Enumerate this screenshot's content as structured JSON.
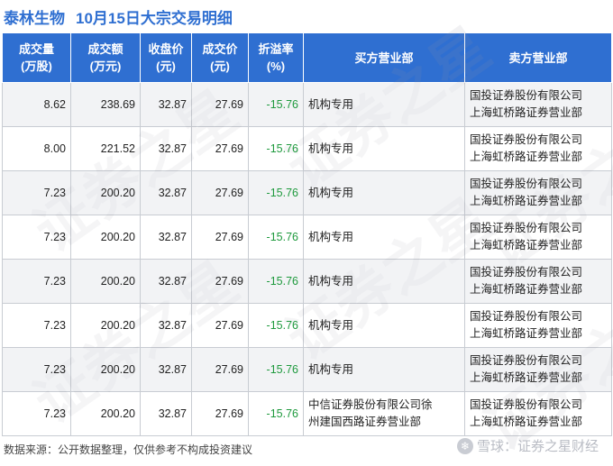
{
  "header": {
    "company": "泰林生物",
    "title": "10月15日大宗交易明细"
  },
  "table": {
    "columns": [
      {
        "l1": "成交量",
        "l2": "(万股)"
      },
      {
        "l1": "成交额",
        "l2": "(万元)"
      },
      {
        "l1": "收盘价",
        "l2": "(元)"
      },
      {
        "l1": "成交价",
        "l2": "(元)"
      },
      {
        "l1": "折溢率",
        "l2": "(%)"
      },
      {
        "l1": "买方营业部",
        "l2": ""
      },
      {
        "l1": "卖方营业部",
        "l2": ""
      }
    ],
    "rows": [
      {
        "volume": "8.62",
        "amount": "238.69",
        "close": "32.87",
        "price": "27.69",
        "premium": "-15.76",
        "buyer1": "机构专用",
        "buyer2": "",
        "seller1": "国投证券股份有限公司",
        "seller2": "上海虹桥路证券营业部"
      },
      {
        "volume": "8.00",
        "amount": "221.52",
        "close": "32.87",
        "price": "27.69",
        "premium": "-15.76",
        "buyer1": "机构专用",
        "buyer2": "",
        "seller1": "国投证券股份有限公司",
        "seller2": "上海虹桥路证券营业部"
      },
      {
        "volume": "7.23",
        "amount": "200.20",
        "close": "32.87",
        "price": "27.69",
        "premium": "-15.76",
        "buyer1": "机构专用",
        "buyer2": "",
        "seller1": "国投证券股份有限公司",
        "seller2": "上海虹桥路证券营业部"
      },
      {
        "volume": "7.23",
        "amount": "200.20",
        "close": "32.87",
        "price": "27.69",
        "premium": "-15.76",
        "buyer1": "机构专用",
        "buyer2": "",
        "seller1": "国投证券股份有限公司",
        "seller2": "上海虹桥路证券营业部"
      },
      {
        "volume": "7.23",
        "amount": "200.20",
        "close": "32.87",
        "price": "27.69",
        "premium": "-15.76",
        "buyer1": "机构专用",
        "buyer2": "",
        "seller1": "国投证券股份有限公司",
        "seller2": "上海虹桥路证券营业部"
      },
      {
        "volume": "7.23",
        "amount": "200.20",
        "close": "32.87",
        "price": "27.69",
        "premium": "-15.76",
        "buyer1": "机构专用",
        "buyer2": "",
        "seller1": "国投证券股份有限公司",
        "seller2": "上海虹桥路证券营业部"
      },
      {
        "volume": "7.23",
        "amount": "200.20",
        "close": "32.87",
        "price": "27.69",
        "premium": "-15.76",
        "buyer1": "机构专用",
        "buyer2": "",
        "seller1": "国投证券股份有限公司",
        "seller2": "上海虹桥路证券营业部"
      },
      {
        "volume": "7.23",
        "amount": "200.20",
        "close": "32.87",
        "price": "27.69",
        "premium": "-15.76",
        "buyer1": "中信证券股份有限公司徐",
        "buyer2": "州建国西路证券营业部",
        "seller1": "国投证券股份有限公司",
        "seller2": "上海虹桥路证券营业部"
      }
    ]
  },
  "footer": {
    "source": "数据来源：公开数据整理，仅供参考不构成投资建议",
    "brand": "雪球：证券之星财经",
    "brand_icon": "snowball-icon"
  },
  "watermark": "证券之星",
  "colors": {
    "brand_blue": "#2f6fd1",
    "negative_green": "#1f9a3e",
    "row_stripe": "#e8e9ec"
  }
}
